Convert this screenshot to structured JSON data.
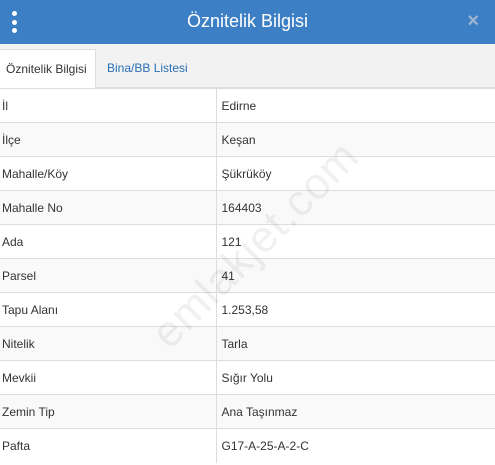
{
  "header": {
    "title": "Öznitelik Bilgisi",
    "menu_icon": "kebab-menu-icon",
    "close_icon": "close-icon",
    "close_glyph": "×",
    "background": "#3d7fc5"
  },
  "tabs": [
    {
      "label": "Öznitelik Bilgisi",
      "active": true
    },
    {
      "label": "Bina/BB Listesi",
      "active": false
    }
  ],
  "rows": [
    {
      "key": "İl",
      "value": "Edirne"
    },
    {
      "key": "İlçe",
      "value": "Keşan"
    },
    {
      "key": "Mahalle/Köy",
      "value": "Şükrüköy"
    },
    {
      "key": "Mahalle No",
      "value": "164403"
    },
    {
      "key": "Ada",
      "value": "121"
    },
    {
      "key": "Parsel",
      "value": "41"
    },
    {
      "key": "Tapu Alanı",
      "value": "1.253,58"
    },
    {
      "key": "Nitelik",
      "value": "Tarla"
    },
    {
      "key": "Mevkii",
      "value": "Sığır Yolu"
    },
    {
      "key": "Zemin Tip",
      "value": "Ana Taşınmaz"
    },
    {
      "key": "Pafta",
      "value": "G17-A-25-A-2-C"
    }
  ],
  "watermark": "emlakjet.com"
}
